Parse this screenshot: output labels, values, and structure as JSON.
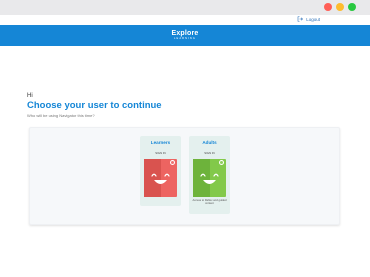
{
  "header": {
    "logout_label": "Logout",
    "logo_top": "Explore",
    "logo_bottom": "LEARNING"
  },
  "main": {
    "greeting": "Hi",
    "title": "Choose your user to continue",
    "subtitle": "Who will be using Navigator this time?"
  },
  "cards": [
    {
      "title": "Learners",
      "prompt": "SIGN IN",
      "avatar_color": "#ed6461",
      "icon": "smiley-face-icon"
    },
    {
      "title": "Adults",
      "prompt": "SIGN IN",
      "avatar_color": "#82c94a",
      "icon": "smiley-face-icon",
      "note": "Access to Reflex and guided content"
    }
  ],
  "colors": {
    "brand": "#1586d6",
    "learners": "#ed6461",
    "adults": "#82c94a"
  }
}
